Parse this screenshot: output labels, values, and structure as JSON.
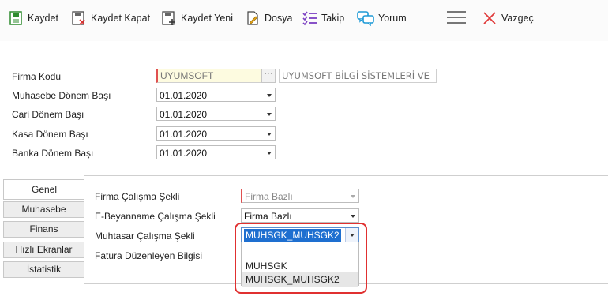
{
  "toolbar": {
    "save": "Kaydet",
    "save_close": "Kaydet Kapat",
    "save_new": "Kaydet Yeni",
    "file": "Dosya",
    "follow": "Takip",
    "comment": "Yorum",
    "cancel": "Vazgeç"
  },
  "form": {
    "firma_kodu": {
      "label": "Firma Kodu",
      "value": "UYUMSOFT",
      "description": "UYUMSOFT BİLGİ SİSTEMLERİ VE",
      "button": "···"
    },
    "muhasebe": {
      "label": "Muhasebe Dönem Başı",
      "value": "01.01.2020"
    },
    "cari": {
      "label": "Cari Dönem Başı",
      "value": "01.01.2020"
    },
    "kasa": {
      "label": "Kasa Dönem Başı",
      "value": "01.01.2020"
    },
    "banka": {
      "label": "Banka Dönem Başı",
      "value": "01.01.2020"
    }
  },
  "tabs": [
    "Genel",
    "Muhasebe",
    "Finans",
    "Hızlı Ekranlar",
    "İstatistik"
  ],
  "panel": {
    "firma_calisma": {
      "label": "Firma Çalışma Şekli",
      "value": "Firma Bazlı"
    },
    "ebeyanname": {
      "label": "E-Beyanname Çalışma Şekli",
      "value": "Firma Bazlı"
    },
    "muhtasar": {
      "label": "Muhtasar Çalışma Şekli",
      "value": "MUHSGK_MUHSGK2"
    },
    "fatura": {
      "label": "Fatura Düzenleyen Bilgisi"
    }
  },
  "dropdown": {
    "options": [
      "MUHSGK",
      "MUHSGK_MUHSGK2"
    ]
  },
  "colors": {
    "highlight": "#e03030",
    "selection": "#1e6fd0",
    "required": "#e05050"
  }
}
